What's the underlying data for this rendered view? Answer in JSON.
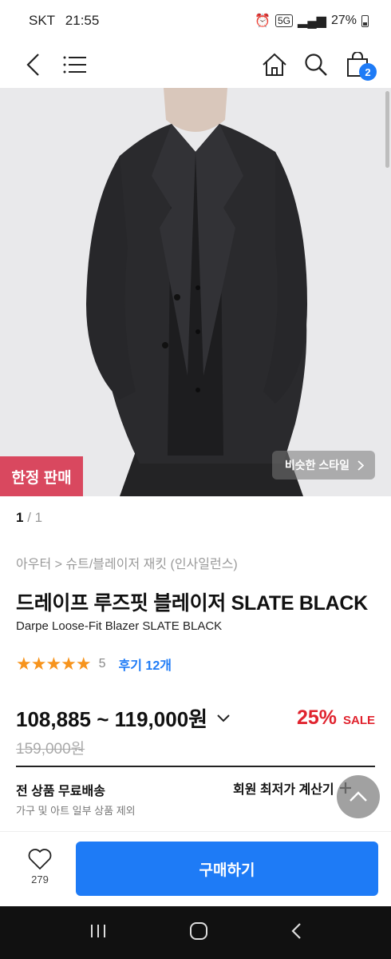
{
  "status_bar": {
    "carrier": "SKT",
    "time": "21:55",
    "network": "5G",
    "battery": "27%"
  },
  "header": {
    "icons": [
      "back-icon",
      "menu-icon",
      "home-icon",
      "search-icon",
      "cart-icon"
    ],
    "cart_count": "2"
  },
  "hero": {
    "limited_badge": "한정 판매",
    "similar_style": "비슷한 스타일"
  },
  "pager": {
    "current": "1",
    "separator": "/",
    "total": "1"
  },
  "product": {
    "breadcrumb": "아우터 > 슈트/블레이저 재킷 (인사일런스)",
    "title_ko": "드레이프 루즈핏 블레이저 SLATE BLACK",
    "title_en": "Darpe Loose-Fit Blazer SLATE BLACK",
    "rating": "5",
    "stars": 5,
    "review_label": "후기 12개",
    "price_range": "108,885 ~ 119,000원",
    "discount_pct": "25%",
    "sale_label": "SALE",
    "original_price": "159,000원"
  },
  "shipping": {
    "main": "전 상품 무료배송",
    "sub": "가구 및 아트 일부 상품 제외",
    "member_calc": "회원 최저가 계산기"
  },
  "bottom_bar": {
    "like_count": "279",
    "buy_label": "구매하기"
  },
  "colors": {
    "accent_blue": "#1e7bf6",
    "sale_red": "#e0232e",
    "badge_red": "#d9485f",
    "star_orange": "#f7941d"
  }
}
